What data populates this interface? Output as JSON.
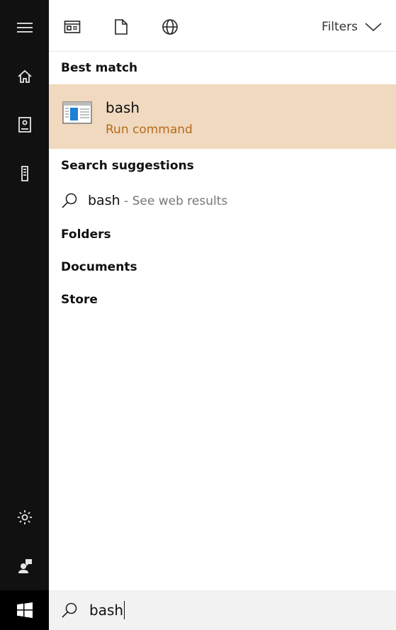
{
  "rail": {
    "items": [
      {
        "icon": "hamburger-menu-icon"
      },
      {
        "icon": "home-icon"
      },
      {
        "icon": "notebook-icon"
      },
      {
        "icon": "device-icon"
      },
      {
        "icon": "gear-icon"
      },
      {
        "icon": "feedback-icon"
      },
      {
        "icon": "windows-start-icon"
      }
    ]
  },
  "topbar": {
    "tabs": [
      {
        "icon": "apps-icon"
      },
      {
        "icon": "documents-icon"
      },
      {
        "icon": "web-globe-icon"
      }
    ],
    "filters_label": "Filters"
  },
  "results": {
    "best_match_title": "Best match",
    "best": {
      "name": "bash",
      "subtitle": "Run command",
      "icon": "app-window-icon"
    },
    "suggestions_title": "Search suggestions",
    "suggestion": {
      "query": "bash",
      "sep": " - See web results"
    },
    "categories": [
      "Folders",
      "Documents",
      "Store"
    ]
  },
  "search": {
    "value": "bash",
    "icon": "search-icon"
  },
  "colors": {
    "rail_bg": "#111111",
    "highlight_bg": "#f0d9bf",
    "accent_text": "#b56b1c"
  }
}
